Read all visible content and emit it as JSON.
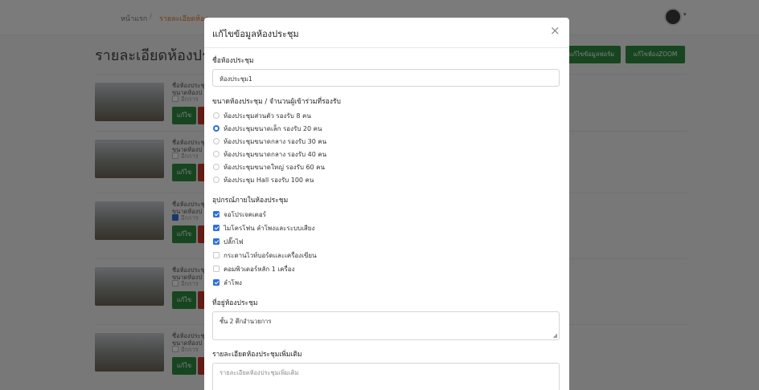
{
  "topbar": {
    "home": "หน้าแรก",
    "separator": "/",
    "current": "รายละเอียดห้อง"
  },
  "page": {
    "title": "รายละเอียดห้องประชุ",
    "buttons": {
      "edit_form": "แก้ไขข้อมูลฟอร์ม",
      "edit_zoom": "แก้ไขห้องZOOM"
    }
  },
  "cards": [
    {
      "name": "ชื่อห้องประชุ",
      "size": "ขนาดห้องป",
      "equipment": "อีกการ",
      "checked": false,
      "edit": "แก้ไข"
    },
    {
      "name": "ชื่อห้องประชุ",
      "size": "ขนาดห้องป",
      "equipment": "อีกการ",
      "checked": false,
      "edit": "แก้ไข"
    },
    {
      "name": "ชื่อห้องประชุ",
      "size": "ขนาดห้องป",
      "equipment": "อีกการ",
      "checked": true,
      "edit": "แก้ไข"
    },
    {
      "name": "ชื่อห้องประชุ",
      "size": "ขนาดห้องป",
      "equipment": "อีกการ",
      "checked": false,
      "edit": "แก้ไข"
    },
    {
      "name": "ชื่อห้องประชุ",
      "size": "ขนาดห้องป",
      "equipment": "อีกการ",
      "checked": false,
      "edit": "แก้ไข"
    }
  ],
  "modal": {
    "title": "แก้ไขข้อมูลห้องประชุม",
    "close": "×",
    "name_label": "ชื่อห้องประชุม",
    "name_value": "ห้องประชุม1",
    "size_label": "ขนาดห้องประชุม / จำนวนผู้เข้าร่วมที่รองรับ",
    "size_options": [
      {
        "label": "ห้องประชุมส่วนตัว รองรับ 8 คน",
        "selected": false
      },
      {
        "label": "ห้องประชุมขนาดเล็ก รองรับ 20 คน",
        "selected": true
      },
      {
        "label": "ห้องประชุมขนาดกลาง รองรับ 30 คน",
        "selected": false
      },
      {
        "label": "ห้องประชุมขนาดกลาง รองรับ 40 คน",
        "selected": false
      },
      {
        "label": "ห้องประชุมขนาดใหญ่ รองรับ 60 คน",
        "selected": false
      },
      {
        "label": "ห้องประชุม Hall รองรับ 100 คน",
        "selected": false
      }
    ],
    "equipment_label": "อุปกรณ์ภายในห้องประชุม",
    "equipment": [
      {
        "label": "จอโปรเจคเตอร์",
        "checked": true
      },
      {
        "label": "ไมโครโฟน ลำโพงและระบบเสียง",
        "checked": true
      },
      {
        "label": "ปลั๊กไฟ",
        "checked": true
      },
      {
        "label": "กระดานไวท์บอร์ดและเครื่องเขียน",
        "checked": false
      },
      {
        "label": "คอมพิวเตอร์หลัก 1 เครื่อง",
        "checked": false
      },
      {
        "label": "ลำโพง",
        "checked": true
      }
    ],
    "location_label": "ที่อยู่ห้องประชุม",
    "location_value": "ชั้น 2 ตึกอำนวยการ",
    "detail_label": "รายละเอียดห้องประชุมเพิ่มเติม",
    "detail_placeholder": "รายละเอียดห้องประชุมเพิ่มเติม"
  },
  "colors": {
    "accent": "#2f6fdb",
    "green": "#2e8b3e",
    "danger": "#c0392b",
    "nav_active": "#e07b20"
  }
}
